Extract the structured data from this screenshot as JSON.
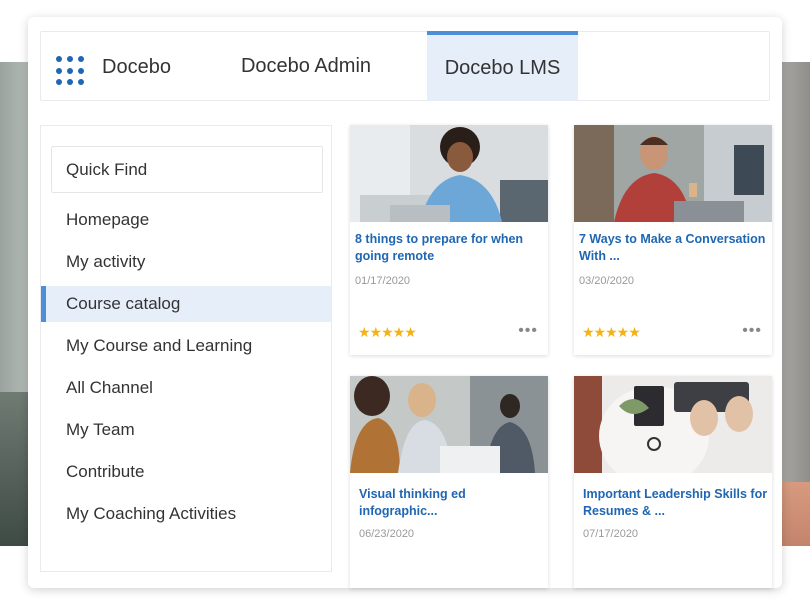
{
  "brand": {
    "name": "Docebo",
    "icon": "grid-dots-icon",
    "color": "#1f66b3"
  },
  "tabs": [
    {
      "label": "Docebo Admin",
      "active": false
    },
    {
      "label": "Docebo LMS",
      "active": true
    }
  ],
  "sidebar": {
    "quick_find": "Quick Find",
    "items": [
      {
        "label": "Homepage"
      },
      {
        "label": "My activity"
      },
      {
        "label": "Course catalog",
        "active": true
      },
      {
        "label": "My Course and Learning"
      },
      {
        "label": "All Channel"
      },
      {
        "label": "My Team"
      },
      {
        "label": "Contribute"
      },
      {
        "label": "My Coaching Activities"
      }
    ]
  },
  "courses": [
    {
      "title": "8 things to prepare for when going remote",
      "date": "01/17/2020",
      "stars": "★★★★★",
      "more": "•••"
    },
    {
      "title": "7 Ways to Make a Conversation With ...",
      "date": "03/20/2020",
      "stars": "★★★★★",
      "more": "•••"
    },
    {
      "title": "Visual thinking ed infographic...",
      "date": "06/23/2020"
    },
    {
      "title": "Important Leadership Skills for Resumes & ...",
      "date": "07/17/2020"
    }
  ],
  "colors": {
    "accent": "#4d8ed9",
    "active_bg": "#e5eef9",
    "link": "#1f66b3",
    "star": "#f2b317"
  }
}
